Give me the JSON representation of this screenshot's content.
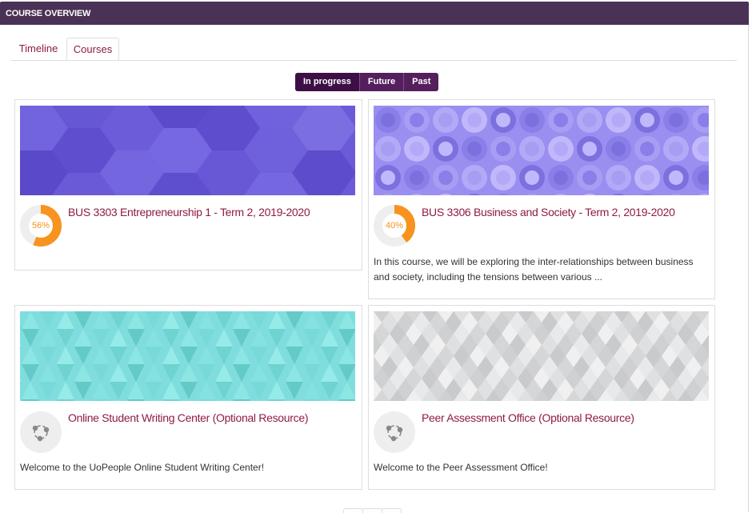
{
  "header": {
    "title": "COURSE OVERVIEW"
  },
  "tabs": [
    {
      "label": "Timeline",
      "active": false
    },
    {
      "label": "Courses",
      "active": true
    }
  ],
  "filters": [
    {
      "label": "In progress",
      "active": true
    },
    {
      "label": "Future",
      "active": false
    },
    {
      "label": "Past",
      "active": false
    }
  ],
  "colors": {
    "header": "#4a3257",
    "accent": "#8e1b48",
    "filter": "#551f5e",
    "progress": "#f7931e"
  },
  "courses": [
    {
      "title": "BUS 3303 Entrepreneurship 1 - Term 2, 2019-2020",
      "progress_percent": 56,
      "progress_label": "56%",
      "description": "",
      "pattern": "hexagon-purple"
    },
    {
      "title": "BUS 3306 Business and Society - Term 2, 2019-2020",
      "progress_percent": 40,
      "progress_label": "40%",
      "description": "In this course, we will be exploring the inter-relationships between business and society, including the tensions between various ...",
      "pattern": "circles-lavender"
    },
    {
      "title": "Online Student Writing Center (Optional Resource)",
      "description": "Welcome to the UoPeople Online Student  Writing Center!",
      "icon": "course-share-icon",
      "pattern": "triangles-teal"
    },
    {
      "title": "Peer Assessment Office (Optional Resource)",
      "description": "Welcome to the Peer Assessment Office!",
      "icon": "course-share-icon",
      "pattern": "diamonds-gray"
    }
  ]
}
